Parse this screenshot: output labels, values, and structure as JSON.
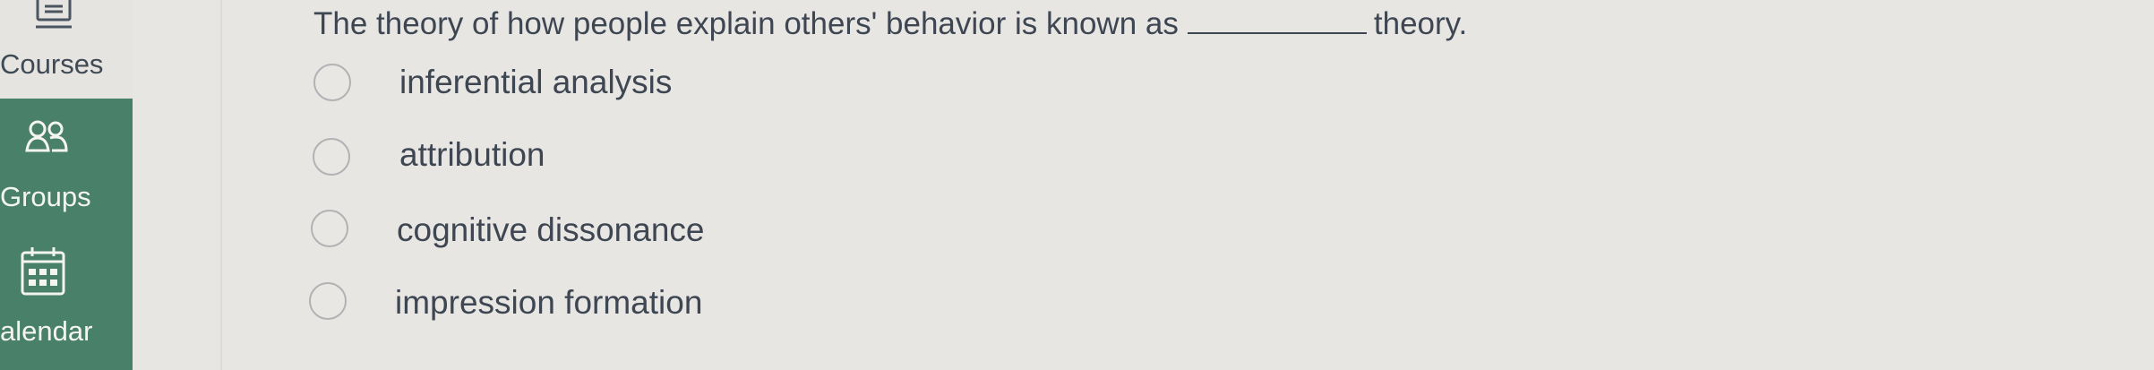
{
  "sidebar": {
    "items": [
      {
        "label": "Courses",
        "icon": "courses-icon"
      },
      {
        "label": "Groups",
        "icon": "groups-icon"
      },
      {
        "label": "alendar",
        "icon": "calendar-icon"
      }
    ],
    "active_color": "#49806a"
  },
  "question": {
    "prefix": "The theory of how people explain others' behavior is known as",
    "suffix": "theory."
  },
  "options": [
    {
      "label": "inferential analysis"
    },
    {
      "label": "attribution"
    },
    {
      "label": "cognitive dissonance"
    },
    {
      "label": "impression formation"
    }
  ]
}
